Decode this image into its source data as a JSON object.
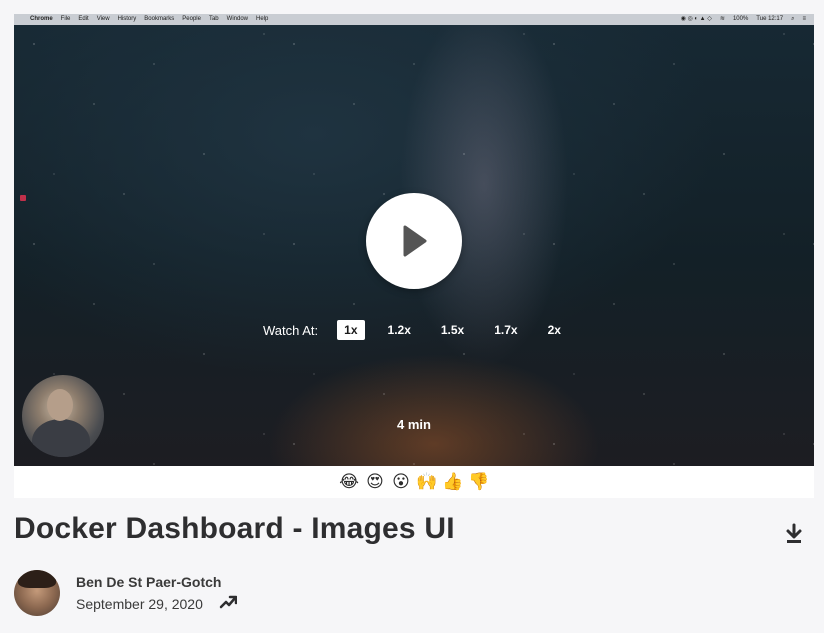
{
  "menubar": {
    "app": "Chrome",
    "items": [
      "File",
      "Edit",
      "View",
      "History",
      "Bookmarks",
      "People",
      "Tab",
      "Window",
      "Help"
    ],
    "battery": "100%",
    "clock": "Tue 12:17"
  },
  "player": {
    "speed_label": "Watch At:",
    "speeds": [
      "1x",
      "1.2x",
      "1.5x",
      "1.7x",
      "2x"
    ],
    "active_speed": "1x",
    "duration": "4 min"
  },
  "reactions": [
    "😂",
    "😍",
    "😮",
    "🙌",
    "👍",
    "👎"
  ],
  "video": {
    "title": "Docker Dashboard - Images UI",
    "author": "Ben De St Paer-Gotch",
    "date": "September 29, 2020"
  },
  "icons": {
    "play": "play-icon",
    "download": "download-icon",
    "trend": "trending-up-icon"
  },
  "colors": {
    "background": "#f6f6f8",
    "title": "#2e2e30",
    "active_speed_bg": "#ffffff"
  }
}
